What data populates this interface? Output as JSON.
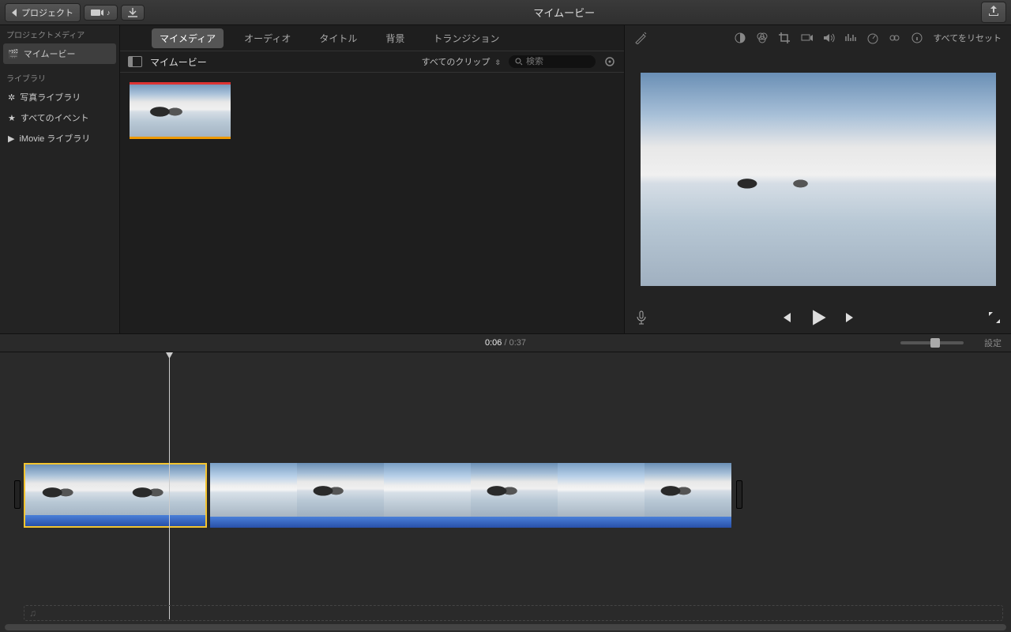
{
  "titlebar": {
    "back_label": "プロジェクト",
    "movie_title": "マイムービー"
  },
  "tabs": {
    "my_media": "マイメディア",
    "audio": "オーディオ",
    "title": "タイトル",
    "background": "背景",
    "transition": "トランジション"
  },
  "sidebar": {
    "project_media_hdr": "プロジェクトメディア",
    "project_item": "マイムービー",
    "library_hdr": "ライブラリ",
    "photo_library": "写真ライブラリ",
    "all_events": "すべてのイベント",
    "imovie_library": "iMovie ライブラリ"
  },
  "browser": {
    "title": "マイムービー",
    "filter_label": "すべてのクリップ",
    "search_placeholder": "検索"
  },
  "adjust": {
    "reset_all": "すべてをリセット"
  },
  "time": {
    "current": "0:06",
    "total": "0:37",
    "settings": "設定"
  }
}
